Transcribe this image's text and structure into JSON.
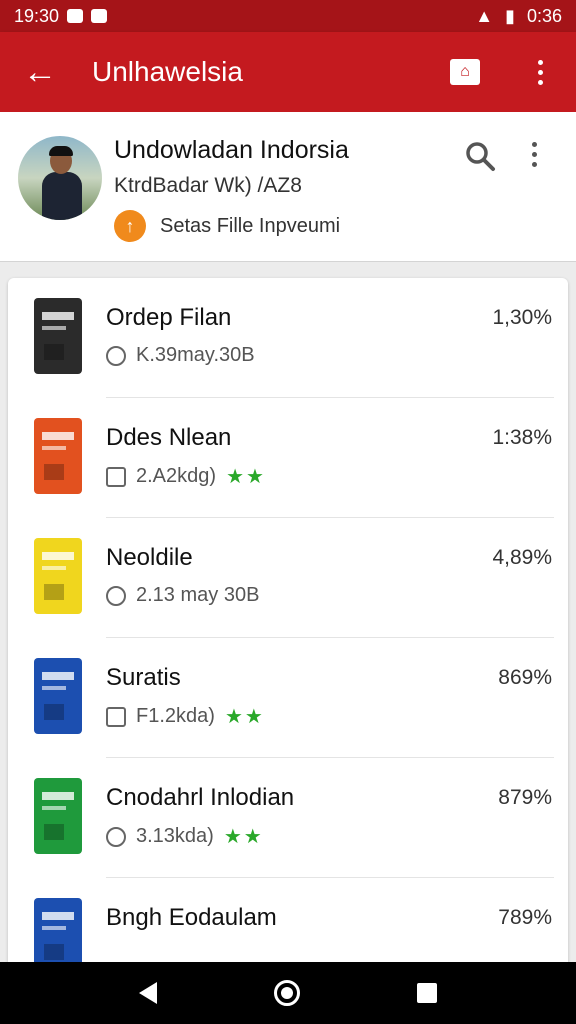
{
  "status_bar": {
    "time": "19:30",
    "clock": "0:36"
  },
  "app_bar": {
    "title": "Unlhawelsia"
  },
  "header": {
    "title": "Undowladan Indorsia",
    "subtitle": "KtrdBadar Wk) /AZ8",
    "status": "Setas Fille Inpveumi"
  },
  "items": [
    {
      "name": "Ordep Filan",
      "meta": "K.39may.30B",
      "percent": "1,30%",
      "stars": "",
      "cover_color": "#2b2b2b"
    },
    {
      "name": "Ddes Nlean",
      "meta": "2.A2kdg)",
      "percent": "1:38%",
      "stars": "★★",
      "cover_color": "#e2511f"
    },
    {
      "name": "Neoldile",
      "meta": "2.13 may 30B",
      "percent": "4,89%",
      "stars": "",
      "cover_color": "#f0d61e"
    },
    {
      "name": "Suratis",
      "meta": "F1.2kda)",
      "percent": "869%",
      "stars": "★★",
      "cover_color": "#1c4fb0"
    },
    {
      "name": "Cnodahrl Inlodian",
      "meta": "3.13kda)",
      "percent": "879%",
      "stars": "★★",
      "cover_color": "#1f9a3c"
    },
    {
      "name": "Bngh Eodaulam",
      "meta": "",
      "percent": "789%",
      "stars": "",
      "cover_color": "#1c4fb0"
    }
  ],
  "colors": {
    "primary": "#c41a1f",
    "status_bar": "#a51418",
    "accent": "#f08a1c",
    "star": "#2aa82a"
  }
}
